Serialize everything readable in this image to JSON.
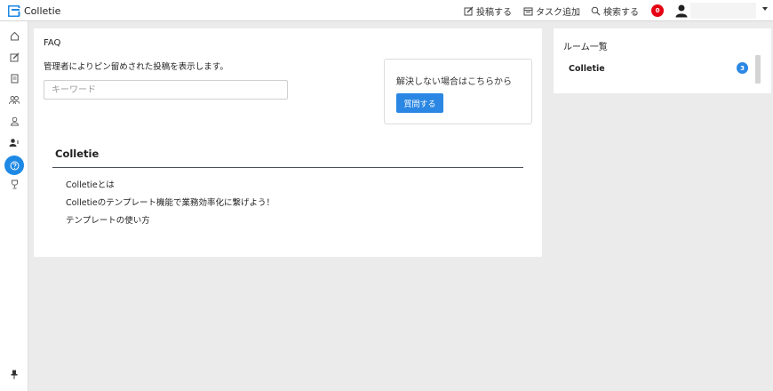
{
  "app": {
    "title": "Colletie"
  },
  "header": {
    "post_label": "投稿する",
    "add_task_label": "タスク追加",
    "search_label": "検索する",
    "notification_count": "0"
  },
  "sidebar": {
    "icons": [
      "home-icon",
      "edit-icon",
      "document-icon",
      "group-icon",
      "user-icon",
      "user-add-icon",
      "help-icon",
      "trophy-icon",
      "pin-icon"
    ],
    "active": "help-icon"
  },
  "faq": {
    "title": "FAQ",
    "description": "管理者によりピン留めされた投稿を表示します。",
    "search_placeholder": "キーワード",
    "search_value": "",
    "help_text": "解決しない場合はこちらから",
    "ask_button_label": "質問する",
    "section_title": "Colletie",
    "items": [
      "Colletieとは",
      "Colletieのテンプレート機能で業務効率化に繋げよう！",
      "テンプレートの使い方"
    ]
  },
  "rooms": {
    "title": "ルーム一覧",
    "items": [
      {
        "name": "Colletie",
        "count": "3"
      }
    ]
  },
  "colors": {
    "accent": "#2b87e3",
    "badge_red": "#e60012",
    "background": "#ebebeb"
  }
}
